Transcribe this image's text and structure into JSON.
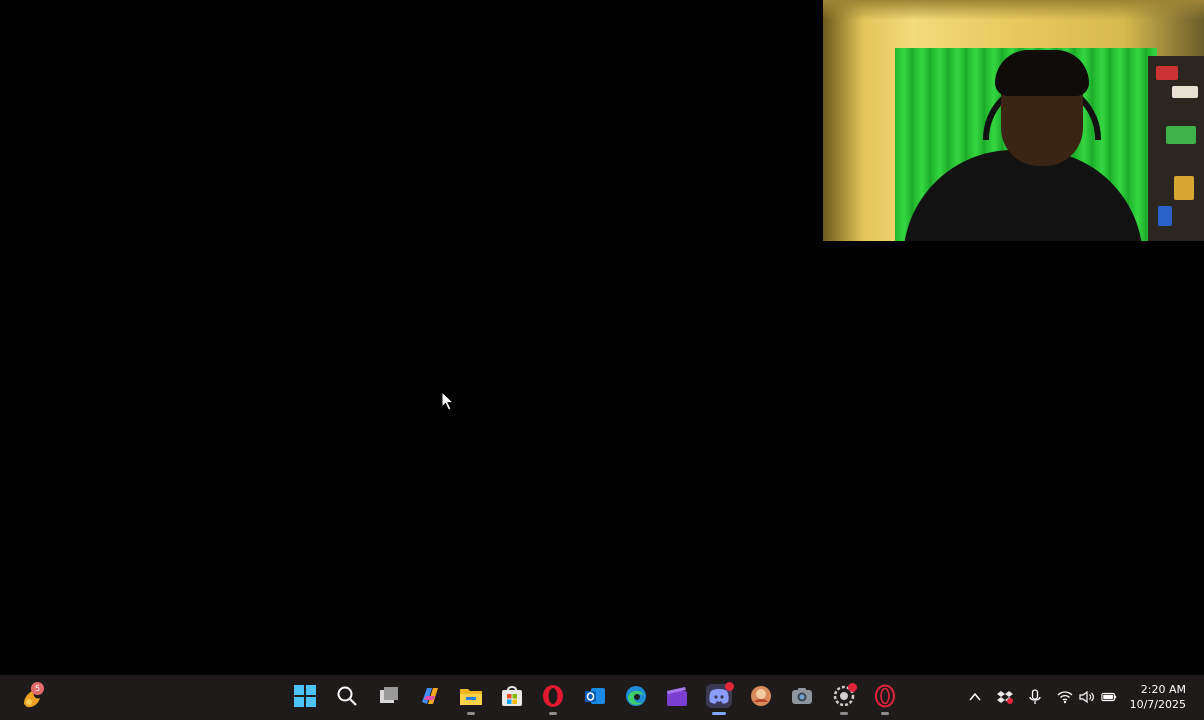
{
  "taskbar": {
    "pinned_apps": [
      {
        "name": "start-button"
      },
      {
        "name": "search-icon"
      },
      {
        "name": "task-view-icon"
      },
      {
        "name": "copilot-icon"
      },
      {
        "name": "file-explorer-icon"
      },
      {
        "name": "microsoft-store-icon"
      },
      {
        "name": "opera-icon"
      },
      {
        "name": "outlook-icon"
      },
      {
        "name": "edge-icon"
      },
      {
        "name": "clipchamp-icon"
      },
      {
        "name": "discord-icon"
      },
      {
        "name": "game-app-icon"
      },
      {
        "name": "camera-icon"
      },
      {
        "name": "settings-app-icon"
      },
      {
        "name": "opera-gx-icon"
      }
    ],
    "widgets": {
      "icon": "weather-widget-icon",
      "badge": "5"
    },
    "clock": {
      "time": "2:20 AM",
      "date": "10/7/2025"
    },
    "tray_icons": [
      "chevron-up-icon",
      "dropbox-icon",
      "microphone-icon",
      "wifi-icon",
      "volume-icon",
      "battery-icon"
    ],
    "colors": {
      "taskbar_bg": "#1e1b1a",
      "active_indicator": "#7ea7ff"
    }
  }
}
